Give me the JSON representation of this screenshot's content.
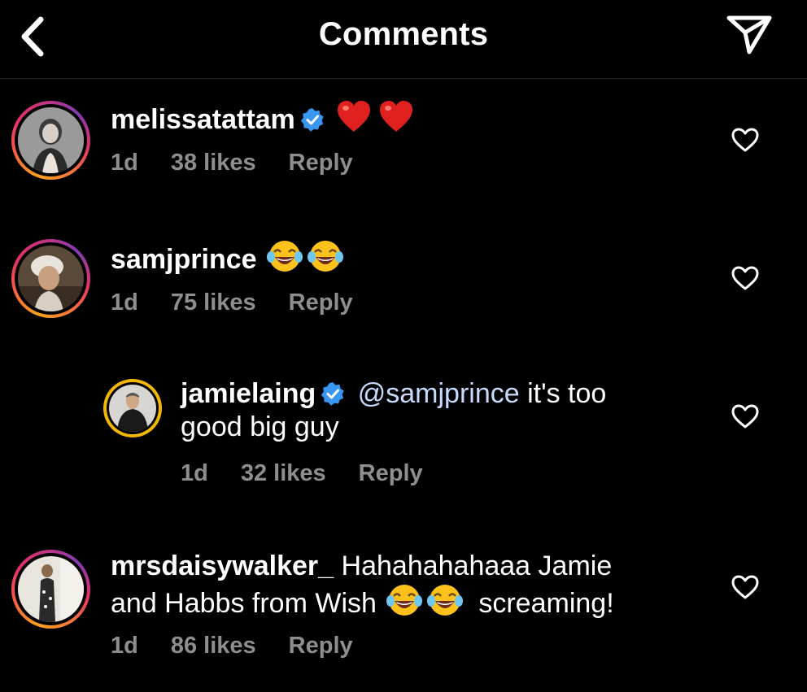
{
  "header": {
    "title": "Comments"
  },
  "comments": [
    {
      "username": "melissatattam",
      "verified": true,
      "emoji": [
        "heart",
        "heart"
      ],
      "text": "",
      "time": "1d",
      "likes": "38 likes",
      "reply": "Reply"
    },
    {
      "username": "samjprince",
      "verified": false,
      "emoji": [
        "laugh",
        "laugh"
      ],
      "text": "",
      "time": "1d",
      "likes": "75 likes",
      "reply": "Reply"
    },
    {
      "username": "jamielaing",
      "verified": true,
      "mention": "@samjprince",
      "text_line1": "it's too",
      "text_line2": "good big guy",
      "time": "1d",
      "likes": "32 likes",
      "reply": "Reply"
    },
    {
      "username": "mrsdaisywalker_",
      "verified": false,
      "text_line1": "Hahahahahaaa Jamie",
      "text_line2a": "and Habbs from Wish",
      "text_line2b": "screaming!",
      "time": "1d",
      "likes": "86 likes",
      "reply": "Reply"
    }
  ],
  "colors": {
    "background": "#000000",
    "text": "#ffffff",
    "meta": "#8e8e8e",
    "mention": "#c7dbff",
    "verified": "#3897f0"
  }
}
